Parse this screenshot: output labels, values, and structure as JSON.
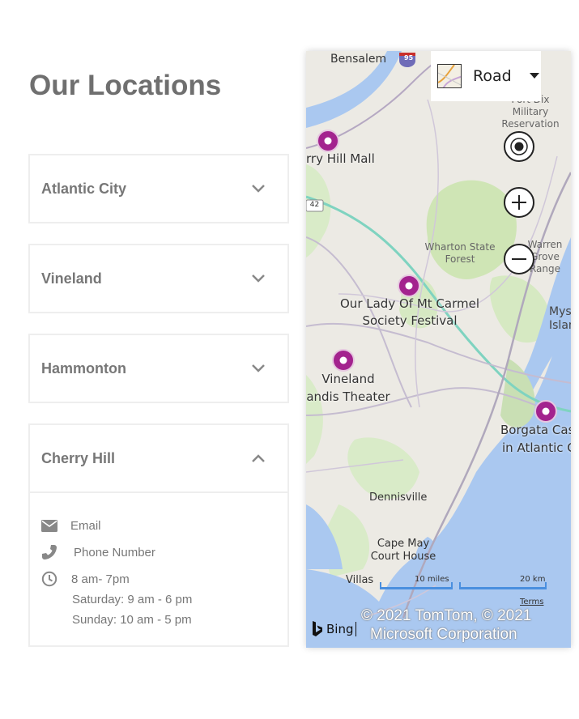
{
  "page": {
    "title": "Our Locations"
  },
  "locations": [
    {
      "name": "Atlantic City",
      "expanded": false
    },
    {
      "name": "Vineland",
      "expanded": false
    },
    {
      "name": "Hammonton",
      "expanded": false
    },
    {
      "name": "Cherry Hill",
      "expanded": true
    }
  ],
  "details": {
    "email_label": "Email",
    "phone_label": "Phone Number",
    "hours_label": "8 am- 7pm",
    "saturday": "Saturday: 9 am - 6 pm",
    "sunday": "Sunday: 10 am - 5 pm"
  },
  "map": {
    "style_label": "Road",
    "places": {
      "bensalem": "Bensalem",
      "fort_dix_1": "Fort Dix",
      "fort_dix_2": "Military",
      "fort_dix_3": "Reservation",
      "wharton_1": "Wharton State",
      "wharton_2": "Forest",
      "warren_1": "Warren",
      "warren_2": "Grove",
      "warren_3": "Range",
      "mys_1": "Mys",
      "mys_2": "Islan",
      "dennisville": "Dennisville",
      "cape_may_1": "Cape May",
      "cape_may_2": "Court House",
      "villas": "Villas"
    },
    "route_42": "42",
    "route_95": "95",
    "pins": [
      {
        "label_1": "rry Hill Mall",
        "label_2": ""
      },
      {
        "label_1": "Our Lady Of Mt Carmel",
        "label_2": "Society Festival"
      },
      {
        "label_1": "Vineland",
        "label_2": "andis Theater"
      },
      {
        "label_1": "Borgata Cas",
        "label_2": "in Atlantic C"
      }
    ],
    "scale_miles": "10 miles",
    "scale_km": "20 km",
    "terms": "Terms",
    "bing": "Bing",
    "copyright_1": "© 2021 TomTom, © 2021",
    "copyright_2": "Microsoft Corporation"
  },
  "colors": {
    "accent_pin": "#a3238e",
    "water": "#aac8f0",
    "forest": "#cfe5b5",
    "land": "#eceae4"
  }
}
